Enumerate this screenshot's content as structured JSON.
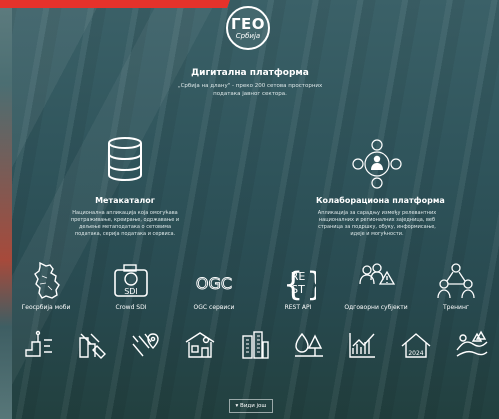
{
  "header": {
    "logo_text": "ГЕО",
    "logo_subtext": "Србија",
    "title": "Дигитална платформа",
    "subtitle": "„Србија на длану\" - преко 200 сетова просторних података јавног сектора."
  },
  "features": [
    {
      "title": "Метакаталог",
      "description": "Национална апликација која омогућава претраживање, креирање, одржавање и дељење метаподатака о сетовима података, серија података и сервиса.",
      "icon": "database-icon"
    },
    {
      "title": "Колаборациона платформа",
      "description": "Апликација за сарадњу између релевантних националних и регионалних заједница, веб страница за подршку, обуку, информисање, идеје и могућности.",
      "icon": "collaboration-icon"
    }
  ],
  "tiles": [
    {
      "label": "Геосрбија моби",
      "icon": "serbia-map-icon"
    },
    {
      "label": "Crowd SDI",
      "icon": "camera-sdi-icon",
      "badge": "SDI"
    },
    {
      "label": "OGC сервиси",
      "icon": "ogc-icon",
      "badge": "OGC"
    },
    {
      "label": "REST API",
      "icon": "rest-api-icon",
      "badge_top": "RE",
      "badge_bottom": "ST"
    },
    {
      "label": "Одговорни субјекти",
      "icon": "responsible-entities-icon"
    },
    {
      "label": "Тренинг",
      "icon": "training-icon"
    }
  ],
  "bottom_icons": [
    "cadastre-parcel-icon",
    "planning-icon",
    "route-map-icon",
    "address-icon",
    "buildings-icon",
    "environment-icon",
    "statistics-icon",
    "census-2024-icon",
    "landscape-icon"
  ],
  "bottom_icon_badge": "2024",
  "more_button": {
    "label": "Види још",
    "icon": "arrow-down-icon"
  }
}
